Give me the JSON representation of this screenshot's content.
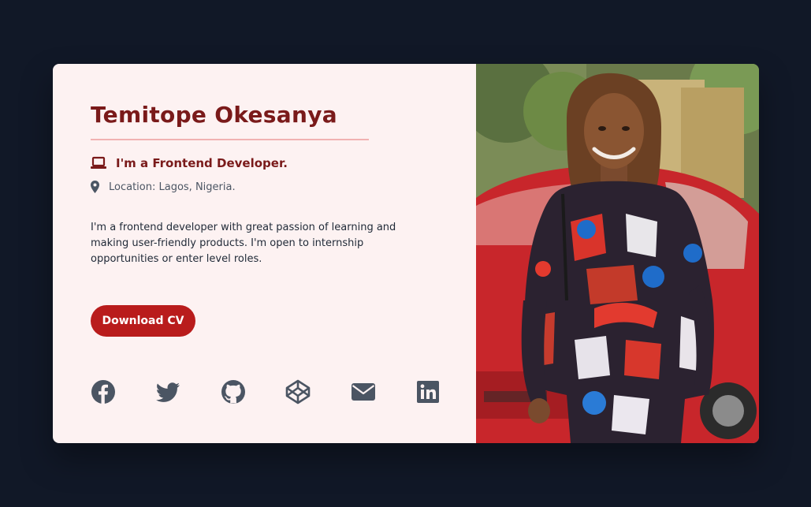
{
  "profile": {
    "name": "Temitope Okesanya",
    "role": "I'm a Frontend Developer.",
    "location": "Location: Lagos, Nigeria.",
    "bio": "I'm a frontend developer with great passion of learning and making user-friendly products. I'm open to internship opportunities or enter level roles."
  },
  "actions": {
    "download_cv_label": "Download CV"
  },
  "socials": [
    {
      "icon": "facebook-icon"
    },
    {
      "icon": "twitter-icon"
    },
    {
      "icon": "github-icon"
    },
    {
      "icon": "codepen-icon"
    },
    {
      "icon": "email-icon"
    },
    {
      "icon": "linkedin-icon"
    }
  ],
  "colors": {
    "page_background": "#111827",
    "card_background": "#fdf2f2",
    "accent": "#b91c1c",
    "heading": "#7a1a1a",
    "icon": "#4b5563"
  }
}
